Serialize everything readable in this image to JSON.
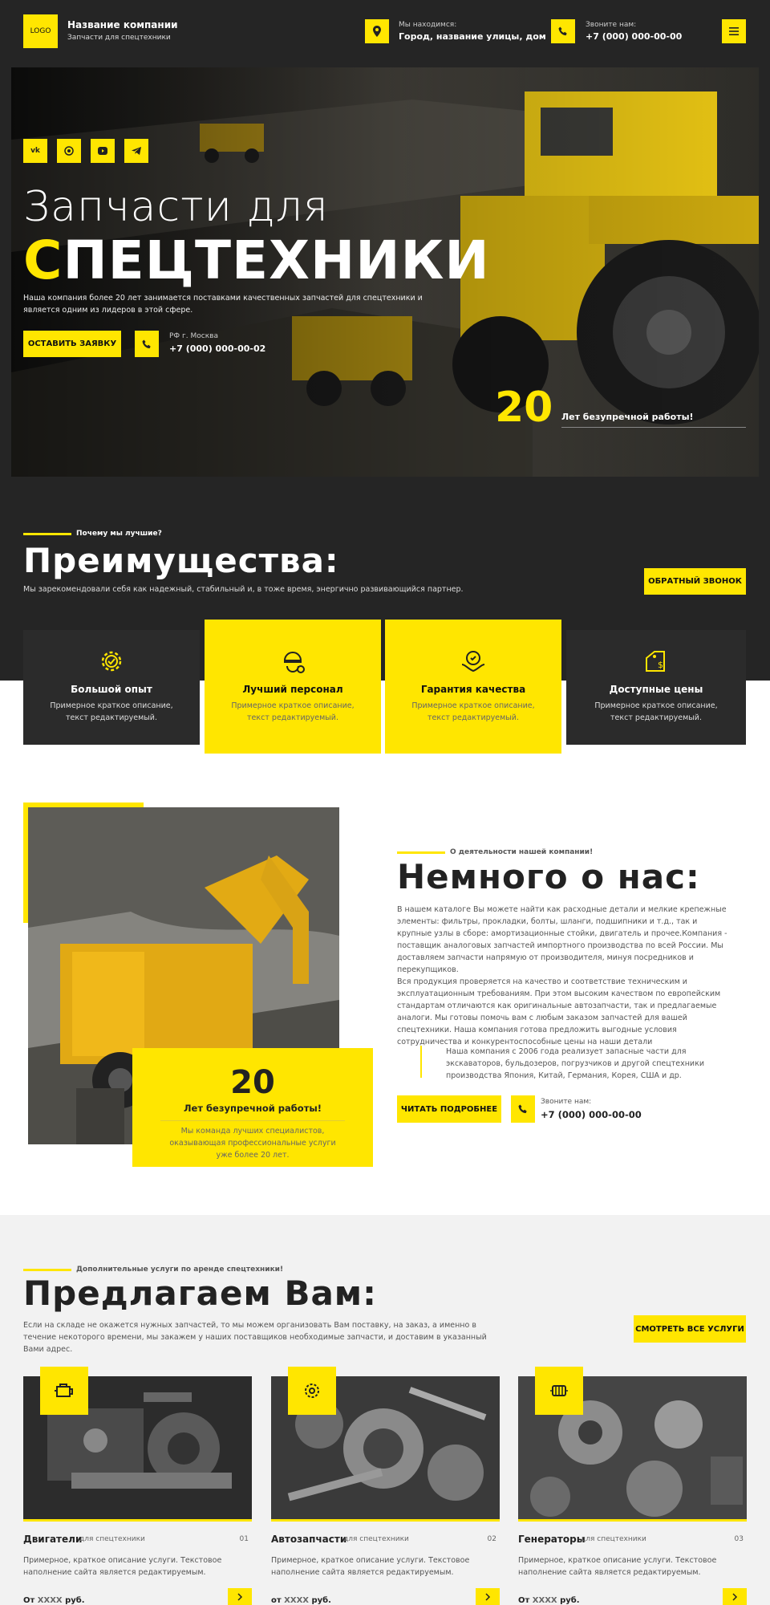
{
  "colors": {
    "accent": "#ffe600",
    "dark": "#252525"
  },
  "header": {
    "logo": "LOGO",
    "company_name": "Название компании",
    "company_tagline": "Запчасти для спецтехники",
    "location_label": "Мы находимся:",
    "location_value": "Город, название улицы, дом",
    "phone_label": "Звоните нам:",
    "phone_value": "+7 (000) 000-00-00",
    "icons": {
      "location": "map-pin-icon",
      "phone": "phone-icon",
      "menu": "hamburger-menu-icon"
    }
  },
  "hero": {
    "socials": [
      "vk-icon",
      "whatsapp-icon",
      "youtube-icon",
      "telegram-icon"
    ],
    "title_line1": "Запчасти для",
    "title_first_letter": "С",
    "title_rest": "ПЕЦТЕХНИКИ",
    "description": "Наша компания более 20 лет занимается поставками качественных запчастей для спецтехники и является одним из лидеров в этой сфере.",
    "cta": "Оставить заявку",
    "phone_caption": "РФ г. Москва",
    "phone": "+7 (000) 000-00-02",
    "years_number": "20",
    "years_text": "Лет безупречной работы!"
  },
  "advantages": {
    "kicker": "Почему мы лучшие?",
    "title": "Преимущества:",
    "subtitle": "Мы зарекомендовали себя как надежный, стабильный и, в тоже время, энергично развивающийся партнер.",
    "callback_button": "Обратный звонок",
    "cards": [
      {
        "icon": "gear-check-icon",
        "title": "Большой опыт",
        "desc": "Примерное краткое описание, текст редактируемый.",
        "highlight": false
      },
      {
        "icon": "worker-helmet-icon",
        "title": "Лучший персонал",
        "desc": "Примерное краткое описание, текст редактируемый.",
        "highlight": true
      },
      {
        "icon": "quality-hands-icon",
        "title": "Гарантия качества",
        "desc": "Примерное краткое описание, текст редактируемый.",
        "highlight": true
      },
      {
        "icon": "price-tag-icon",
        "title": "Доступные цены",
        "desc": "Примерное краткое описание, текст редактируемый.",
        "highlight": false
      }
    ]
  },
  "about": {
    "kicker": "О деятельности нашей компании!",
    "title": "Немного о нас:",
    "p1": "В нашем каталоге Вы можете найти как расходные детали и мелкие крепежные элементы: фильтры, прокладки, болты, шланги, подшипники и т.д., так и крупные узлы в сборе: амортизационные стойки, двигатель и прочее.Компания - поставщик аналоговых запчастей импортного производства по всей России. Мы доставляем запчасти напрямую от производителя, минуя посредников и перекупщиков.",
    "p2": "Вся продукция проверяется на качество и соответствие техническим и эксплуатационным требованиям. При этом высоким качеством по европейским стандартам отличаются как оригинальные автозапчасти, так и предлагаемые аналоги. Мы готовы помочь вам с любым заказом запчастей для вашей спецтехники. Наша компания готова предложить выгодные условия сотрудничества и конкурентоспособные цены на наши детали",
    "quote": "Наша компания с 2006 года реализует запасные части для экскаваторов, бульдозеров, погрузчиков и другой спецтехники производства Япония, Китай, Германия, Корея, США и др.",
    "read_more": "Читать подробнее",
    "phone_label": "Звоните нам:",
    "phone": "+7 (000) 000-00-00",
    "badge_number": "20",
    "badge_title": "Лет безупречной работы!",
    "badge_text": "Мы команда лучших специалистов, оказывающая профессиональные услуги уже более 20 лет."
  },
  "services": {
    "kicker": "Дополнительные услуги по аренде спецтехники!",
    "title": "Предлагаем Вам:",
    "subtitle": "Если на складе не окажется нужных запчастей, то мы можем организовать Вам поставку, на заказ, а именно в течение некоторого времени, мы закажем у наших поставщиков необходимые запчасти, и доставим в указанный Вами адрес.",
    "all_button": "Смотреть все услуги",
    "items": [
      {
        "icon": "engine-icon",
        "title": "Двигатели",
        "sub": "для спецтехники",
        "num": "01",
        "desc": "Примерное, краткое описание услуги. Текстовое наполнение сайта является редактируемым.",
        "price_prefix": "От",
        "price": "XXXX",
        "price_suffix": "руб."
      },
      {
        "icon": "gear-part-icon",
        "title": "Автозапчасти",
        "sub": "для спецтехники",
        "num": "02",
        "desc": "Примерное, краткое описание услуги. Текстовое наполнение сайта является редактируемым.",
        "price_prefix": "от",
        "price": "XXXX",
        "price_suffix": "руб."
      },
      {
        "icon": "generator-icon",
        "title": "Генераторы",
        "sub": "для спецтехники",
        "num": "03",
        "desc": "Примерное, краткое описание услуги. Текстовое наполнение сайта является редактируемым.",
        "price_prefix": "От",
        "price": "XXXX",
        "price_suffix": "руб."
      }
    ]
  }
}
